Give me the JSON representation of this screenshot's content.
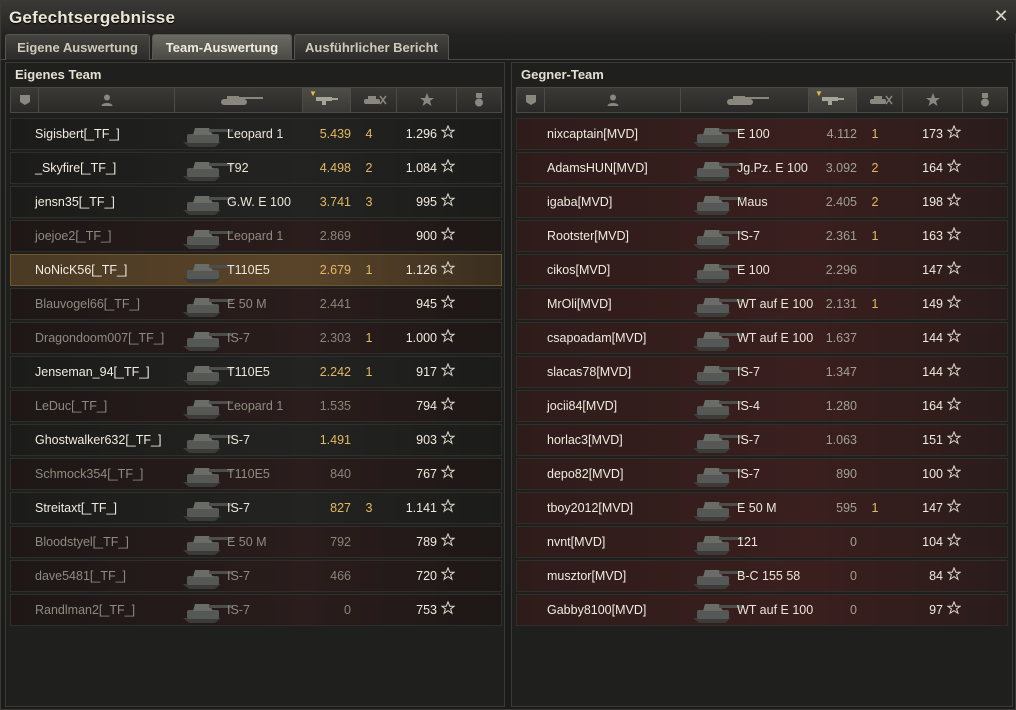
{
  "window": {
    "title": "Gefechtsergebnisse"
  },
  "tabs": [
    {
      "label": "Eigene Auswertung",
      "active": false
    },
    {
      "label": "Team-Auswertung",
      "active": true
    },
    {
      "label": "Ausführlicher Bericht",
      "active": false
    }
  ],
  "own_team": {
    "title": "Eigenes Team",
    "players": [
      {
        "name": "Sigisbert[_TF_]",
        "tank": "Leopard 1",
        "damage": "5.439",
        "kills": "4",
        "xp": "1.296",
        "alive": true
      },
      {
        "name": "_Skyfire[_TF_]",
        "tank": "T92",
        "damage": "4.498",
        "kills": "2",
        "xp": "1.084",
        "alive": true
      },
      {
        "name": "jensn35[_TF_]",
        "tank": "G.W. E 100",
        "damage": "3.741",
        "kills": "3",
        "xp": "995",
        "alive": true
      },
      {
        "name": "joejoe2[_TF_]",
        "tank": "Leopard 1",
        "damage": "2.869",
        "kills": "",
        "xp": "900",
        "alive": false
      },
      {
        "name": "NoNicK56[_TF_]",
        "tank": "T110E5",
        "damage": "2.679",
        "kills": "1",
        "xp": "1.126",
        "alive": true,
        "highlight": true
      },
      {
        "name": "Blauvogel66[_TF_]",
        "tank": "E 50 M",
        "damage": "2.441",
        "kills": "",
        "xp": "945",
        "alive": false
      },
      {
        "name": "Dragondoom007[_TF_]",
        "tank": "IS-7",
        "damage": "2.303",
        "kills": "1",
        "xp": "1.000",
        "alive": false
      },
      {
        "name": "Jenseman_94[_TF_]",
        "tank": "T110E5",
        "damage": "2.242",
        "kills": "1",
        "xp": "917",
        "alive": true
      },
      {
        "name": "LeDuc[_TF_]",
        "tank": "Leopard 1",
        "damage": "1.535",
        "kills": "",
        "xp": "794",
        "alive": false
      },
      {
        "name": "Ghostwalker632[_TF_]",
        "tank": "IS-7",
        "damage": "1.491",
        "kills": "",
        "xp": "903",
        "alive": true
      },
      {
        "name": "Schmock354[_TF_]",
        "tank": "T110E5",
        "damage": "840",
        "kills": "",
        "xp": "767",
        "alive": false
      },
      {
        "name": "Streitaxt[_TF_]",
        "tank": "IS-7",
        "damage": "827",
        "kills": "3",
        "xp": "1.141",
        "alive": true
      },
      {
        "name": "Bloodstyel[_TF_]",
        "tank": "E 50 M",
        "damage": "792",
        "kills": "",
        "xp": "789",
        "alive": false
      },
      {
        "name": "dave5481[_TF_]",
        "tank": "IS-7",
        "damage": "466",
        "kills": "",
        "xp": "720",
        "alive": false
      },
      {
        "name": "Randlman2[_TF_]",
        "tank": "IS-7",
        "damage": "0",
        "kills": "",
        "xp": "753",
        "alive": false
      }
    ]
  },
  "enemy_team": {
    "title": "Gegner-Team",
    "players": [
      {
        "name": "nixcaptain[MVD]",
        "tank": "E 100",
        "damage": "4.112",
        "kills": "1",
        "xp": "173"
      },
      {
        "name": "AdamsHUN[MVD]",
        "tank": "Jg.Pz. E 100",
        "damage": "3.092",
        "kills": "2",
        "xp": "164"
      },
      {
        "name": "igaba[MVD]",
        "tank": "Maus",
        "damage": "2.405",
        "kills": "2",
        "xp": "198"
      },
      {
        "name": "Rootster[MVD]",
        "tank": "IS-7",
        "damage": "2.361",
        "kills": "1",
        "xp": "163"
      },
      {
        "name": "cikos[MVD]",
        "tank": "E 100",
        "damage": "2.296",
        "kills": "",
        "xp": "147"
      },
      {
        "name": "MrOli[MVD]",
        "tank": "WT auf E 100",
        "damage": "2.131",
        "kills": "1",
        "xp": "149"
      },
      {
        "name": "csapoadam[MVD]",
        "tank": "WT auf E 100",
        "damage": "1.637",
        "kills": "",
        "xp": "144"
      },
      {
        "name": "slacas78[MVD]",
        "tank": "IS-7",
        "damage": "1.347",
        "kills": "",
        "xp": "144"
      },
      {
        "name": "jocii84[MVD]",
        "tank": "IS-4",
        "damage": "1.280",
        "kills": "",
        "xp": "164"
      },
      {
        "name": "horlac3[MVD]",
        "tank": "IS-7",
        "damage": "1.063",
        "kills": "",
        "xp": "151"
      },
      {
        "name": "depo82[MVD]",
        "tank": "IS-7",
        "damage": "890",
        "kills": "",
        "xp": "100"
      },
      {
        "name": "tboy2012[MVD]",
        "tank": "E 50 M",
        "damage": "595",
        "kills": "1",
        "xp": "147"
      },
      {
        "name": "nvnt[MVD]",
        "tank": "121",
        "damage": "0",
        "kills": "",
        "xp": "104"
      },
      {
        "name": "musztor[MVD]",
        "tank": "B-C 155 58",
        "damage": "0",
        "kills": "",
        "xp": "84"
      },
      {
        "name": "Gabby8100[MVD]",
        "tank": "WT auf E 100",
        "damage": "0",
        "kills": "",
        "xp": "97"
      }
    ]
  },
  "header_icons": [
    "squad-icon",
    "player-icon",
    "tank-icon",
    "damage-icon",
    "kills-icon",
    "xp-star-icon",
    "medal-icon"
  ],
  "colors": {
    "accent": "#e3b964",
    "enemy_row": "#3a1f1e",
    "highlight_row": "#5a4429"
  }
}
